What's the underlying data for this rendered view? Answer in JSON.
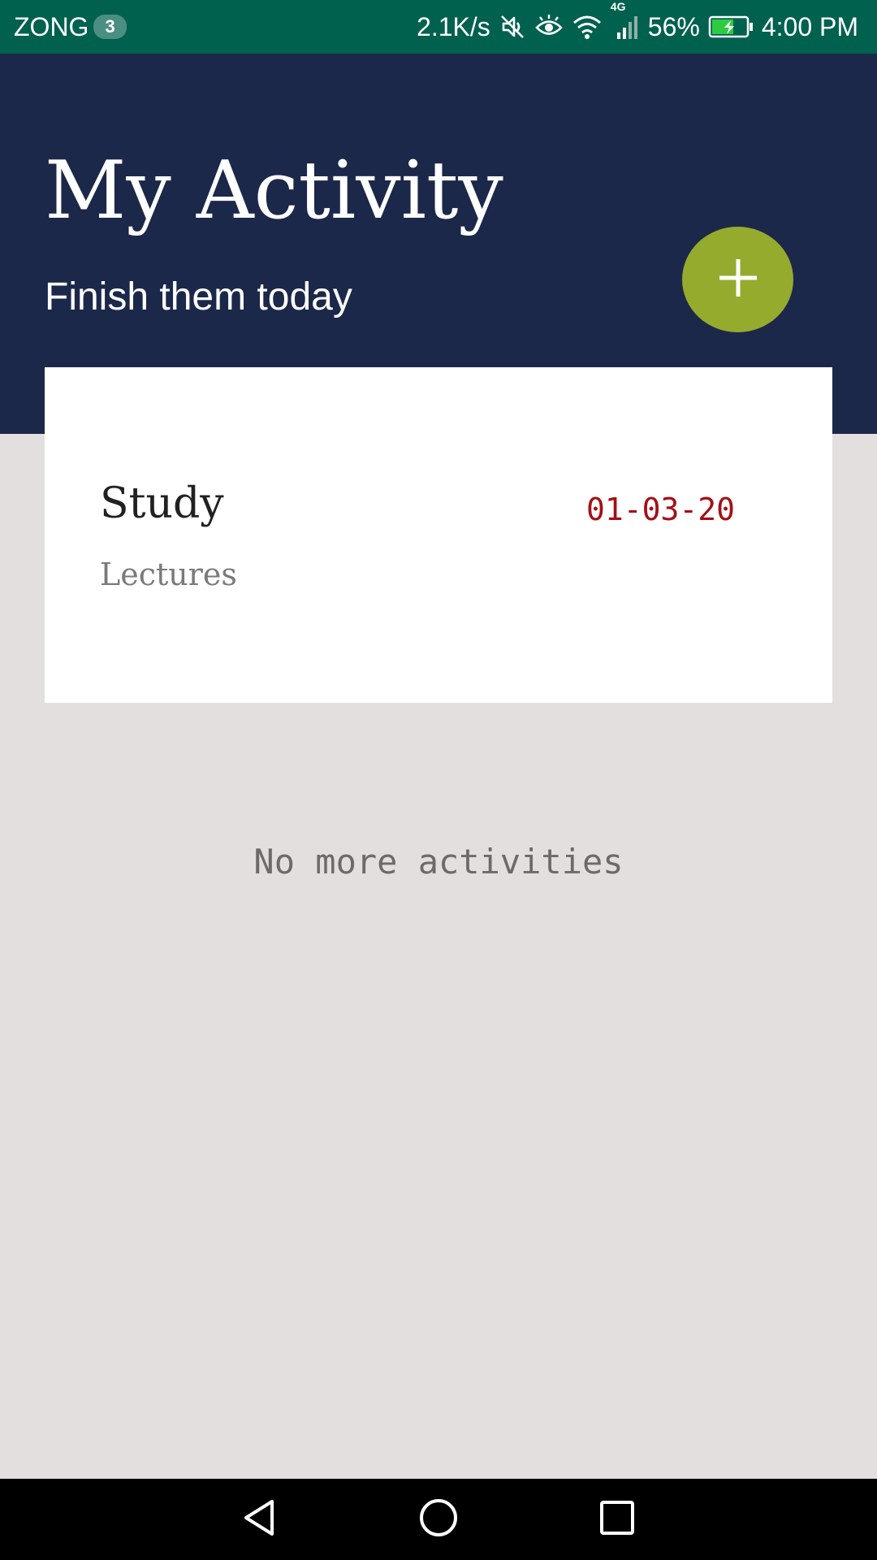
{
  "status_bar": {
    "carrier": "ZONG",
    "sim_badge": "3",
    "network_speed": "2.1K/s",
    "network_type": "4G",
    "battery": "56%",
    "time": "4:00 PM",
    "icons": [
      "mute-icon",
      "eye-comfort-icon",
      "wifi-icon",
      "signal-icon",
      "battery-charging-icon"
    ]
  },
  "header": {
    "title": "My Activity",
    "subtitle": "Finish them today",
    "add_button_icon": "plus-icon"
  },
  "activities": [
    {
      "title": "Study",
      "category": "Lectures",
      "date": "01-03-20"
    }
  ],
  "empty_message": "No more activities",
  "nav_bar": {
    "buttons": [
      "back-icon",
      "home-icon",
      "recents-icon"
    ]
  },
  "colors": {
    "status_bar": "#00614f",
    "header": "#1c284a",
    "background": "#e4dfdf",
    "accent": "#94ab2e",
    "date": "#a50f16"
  }
}
